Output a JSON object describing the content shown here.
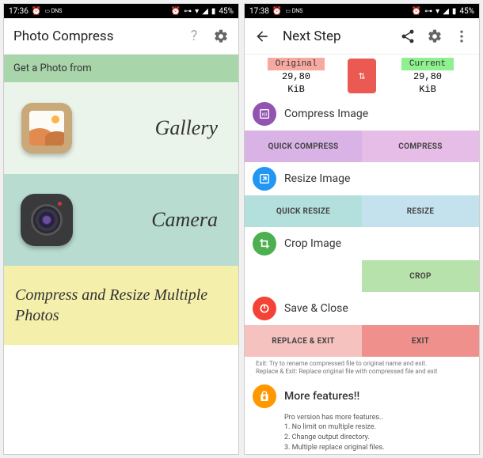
{
  "left": {
    "status": {
      "time": "17:36",
      "battery": "45%"
    },
    "appbar": {
      "title": "Photo Compress"
    },
    "header": "Get a Photo from",
    "gallery": "Gallery",
    "camera": "Camera",
    "multi": "Compress and Resize Multiple Photos"
  },
  "right": {
    "status": {
      "time": "17:38",
      "battery": "45%"
    },
    "appbar": {
      "title": "Next Step"
    },
    "stats": {
      "origLabel": "Original",
      "origVal": "29,80",
      "origUnit": "KiB",
      "currLabel": "Current",
      "currVal": "29,80",
      "currUnit": "KiB"
    },
    "compress": {
      "title": "Compress Image",
      "b1": "QUICK COMPRESS",
      "b2": "COMPRESS"
    },
    "resize": {
      "title": "Resize Image",
      "b1": "QUICK RESIZE",
      "b2": "RESIZE"
    },
    "crop": {
      "title": "Crop Image",
      "b1": "CROP"
    },
    "save": {
      "title": "Save & Close",
      "b1": "REPLACE & EXIT",
      "b2": "EXIT"
    },
    "note1": "Exit: Try to rename compressed file to original name and exit.",
    "note2": "Replace & Exit: Replace original file with compressed file and exit",
    "more": {
      "title": "More features!!",
      "sub": "Pro version has more features..",
      "l1": "1. No limit on multiple resize.",
      "l2": "2. Change output directory.",
      "l3": "3. Multiple replace original files."
    }
  }
}
